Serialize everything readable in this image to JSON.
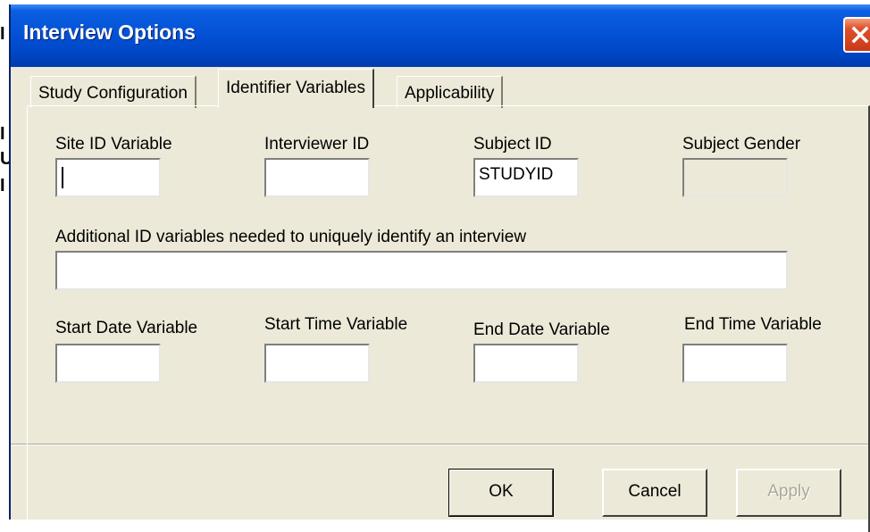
{
  "window": {
    "title": "Interview Options"
  },
  "tabs": [
    {
      "label": "Study Configuration",
      "active": false
    },
    {
      "label": "Identifier Variables",
      "active": true
    },
    {
      "label": "Applicability",
      "active": false
    }
  ],
  "fields": {
    "site_id": {
      "label": "Site ID Variable",
      "value": ""
    },
    "interviewer_id": {
      "label": "Interviewer ID",
      "value": ""
    },
    "subject_id": {
      "label": "Subject ID",
      "value": "STUDYID"
    },
    "subject_gender": {
      "label": "Subject Gender",
      "value": "",
      "enabled": false
    },
    "additional_ids": {
      "label": "Additional ID variables needed to uniquely identify an interview",
      "value": ""
    },
    "start_date": {
      "label": "Start Date Variable",
      "value": ""
    },
    "start_time": {
      "label": "Start Time Variable",
      "value": ""
    },
    "end_date": {
      "label": "End Date Variable",
      "value": ""
    },
    "end_time": {
      "label": "End Time Variable",
      "value": ""
    }
  },
  "buttons": {
    "ok": "OK",
    "cancel": "Cancel",
    "apply": "Apply"
  },
  "icons": {
    "close": "close-icon"
  },
  "colors": {
    "titlebar": "#0554d8",
    "close_button": "#e0502a",
    "dialog_face": "#ece9d8"
  }
}
